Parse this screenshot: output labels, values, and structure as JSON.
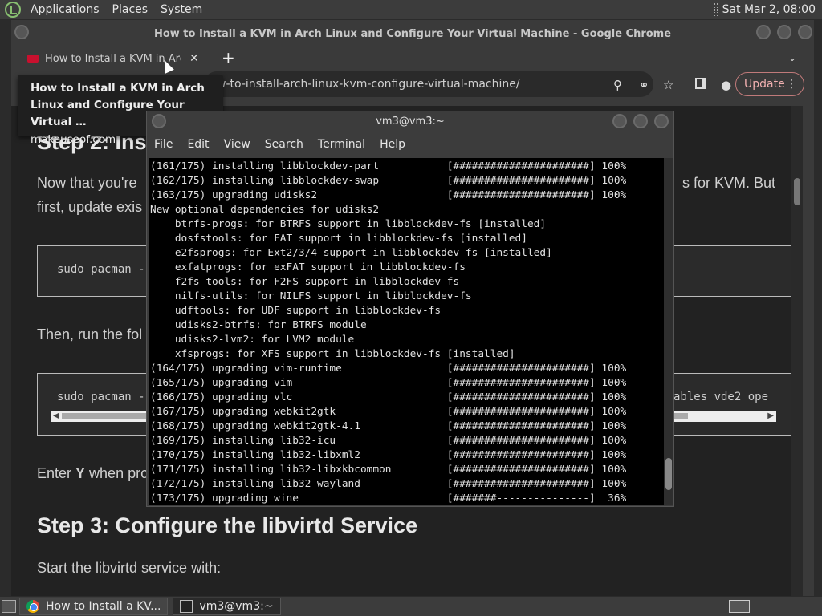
{
  "top_panel": {
    "menus": [
      "Applications",
      "Places",
      "System"
    ],
    "clock": "Sat Mar 2, 08:00"
  },
  "chrome": {
    "window_title": "How to Install a KVM in Arch Linux and Configure Your Virtual Machine - Google Chrome",
    "tab_title": "How to Install a KVM in Arch Linux and Configure Your Virtual Machine",
    "tab_close": "✕",
    "new_tab": "+",
    "tab_search": "⌄",
    "url": "w-to-install-arch-linux-kvm-configure-virtual-machine/",
    "update_label": "Update",
    "menu_dots": "⋮",
    "tooltip_title": "How to Install a KVM in Arch Linux and Configure Your Virtual …",
    "tooltip_site": "makeuseof.com"
  },
  "article": {
    "heading_step2": "Step 2: Ins",
    "para1_line1": "Now that you're",
    "para1_line1_right": "s for KVM. But",
    "para1_line2": "first, update exis",
    "code1": "sudo pacman -",
    "para2": "Then, run the fol",
    "code2_left": "sudo pacman -",
    "code2_right": "ables vde2 ope",
    "para3_prefix": "Enter ",
    "para3_bold": "Y",
    "para3_rest": " when pro",
    "heading_step3": "Step 3: Configure the libvirtd Service",
    "para4": "Start the libvirtd service with:"
  },
  "terminal": {
    "title": "vm3@vm3:~",
    "menus": [
      "File",
      "Edit",
      "View",
      "Search",
      "Terminal",
      "Help"
    ],
    "lines": [
      "(161/175) installing libblockdev-part           [######################] 100%",
      "(162/175) installing libblockdev-swap           [######################] 100%",
      "(163/175) upgrading udisks2                     [######################] 100%",
      "New optional dependencies for udisks2",
      "    btrfs-progs: for BTRFS support in libblockdev-fs [installed]",
      "    dosfstools: for FAT support in libblockdev-fs [installed]",
      "    e2fsprogs: for Ext2/3/4 support in libblockdev-fs [installed]",
      "    exfatprogs: for exFAT support in libblockdev-fs",
      "    f2fs-tools: for F2FS support in libblockdev-fs",
      "    nilfs-utils: for NILFS support in libblockdev-fs",
      "    udftools: for UDF support in libblockdev-fs",
      "    udisks2-btrfs: for BTRFS module",
      "    udisks2-lvm2: for LVM2 module",
      "    xfsprogs: for XFS support in libblockdev-fs [installed]",
      "(164/175) upgrading vim-runtime                 [######################] 100%",
      "(165/175) upgrading vim                         [######################] 100%",
      "(166/175) upgrading vlc                         [######################] 100%",
      "(167/175) upgrading webkit2gtk                  [######################] 100%",
      "(168/175) upgrading webkit2gtk-4.1              [######################] 100%",
      "(169/175) installing lib32-icu                  [######################] 100%",
      "(170/175) installing lib32-libxml2              [######################] 100%",
      "(171/175) installing lib32-libxkbcommon         [######################] 100%",
      "(172/175) installing lib32-wayland              [######################] 100%",
      "(173/175) upgrading wine                        [#######---------------]  36%"
    ]
  },
  "taskbar": {
    "tasks": [
      "How to Install a KV...",
      "vm3@vm3:~"
    ]
  }
}
